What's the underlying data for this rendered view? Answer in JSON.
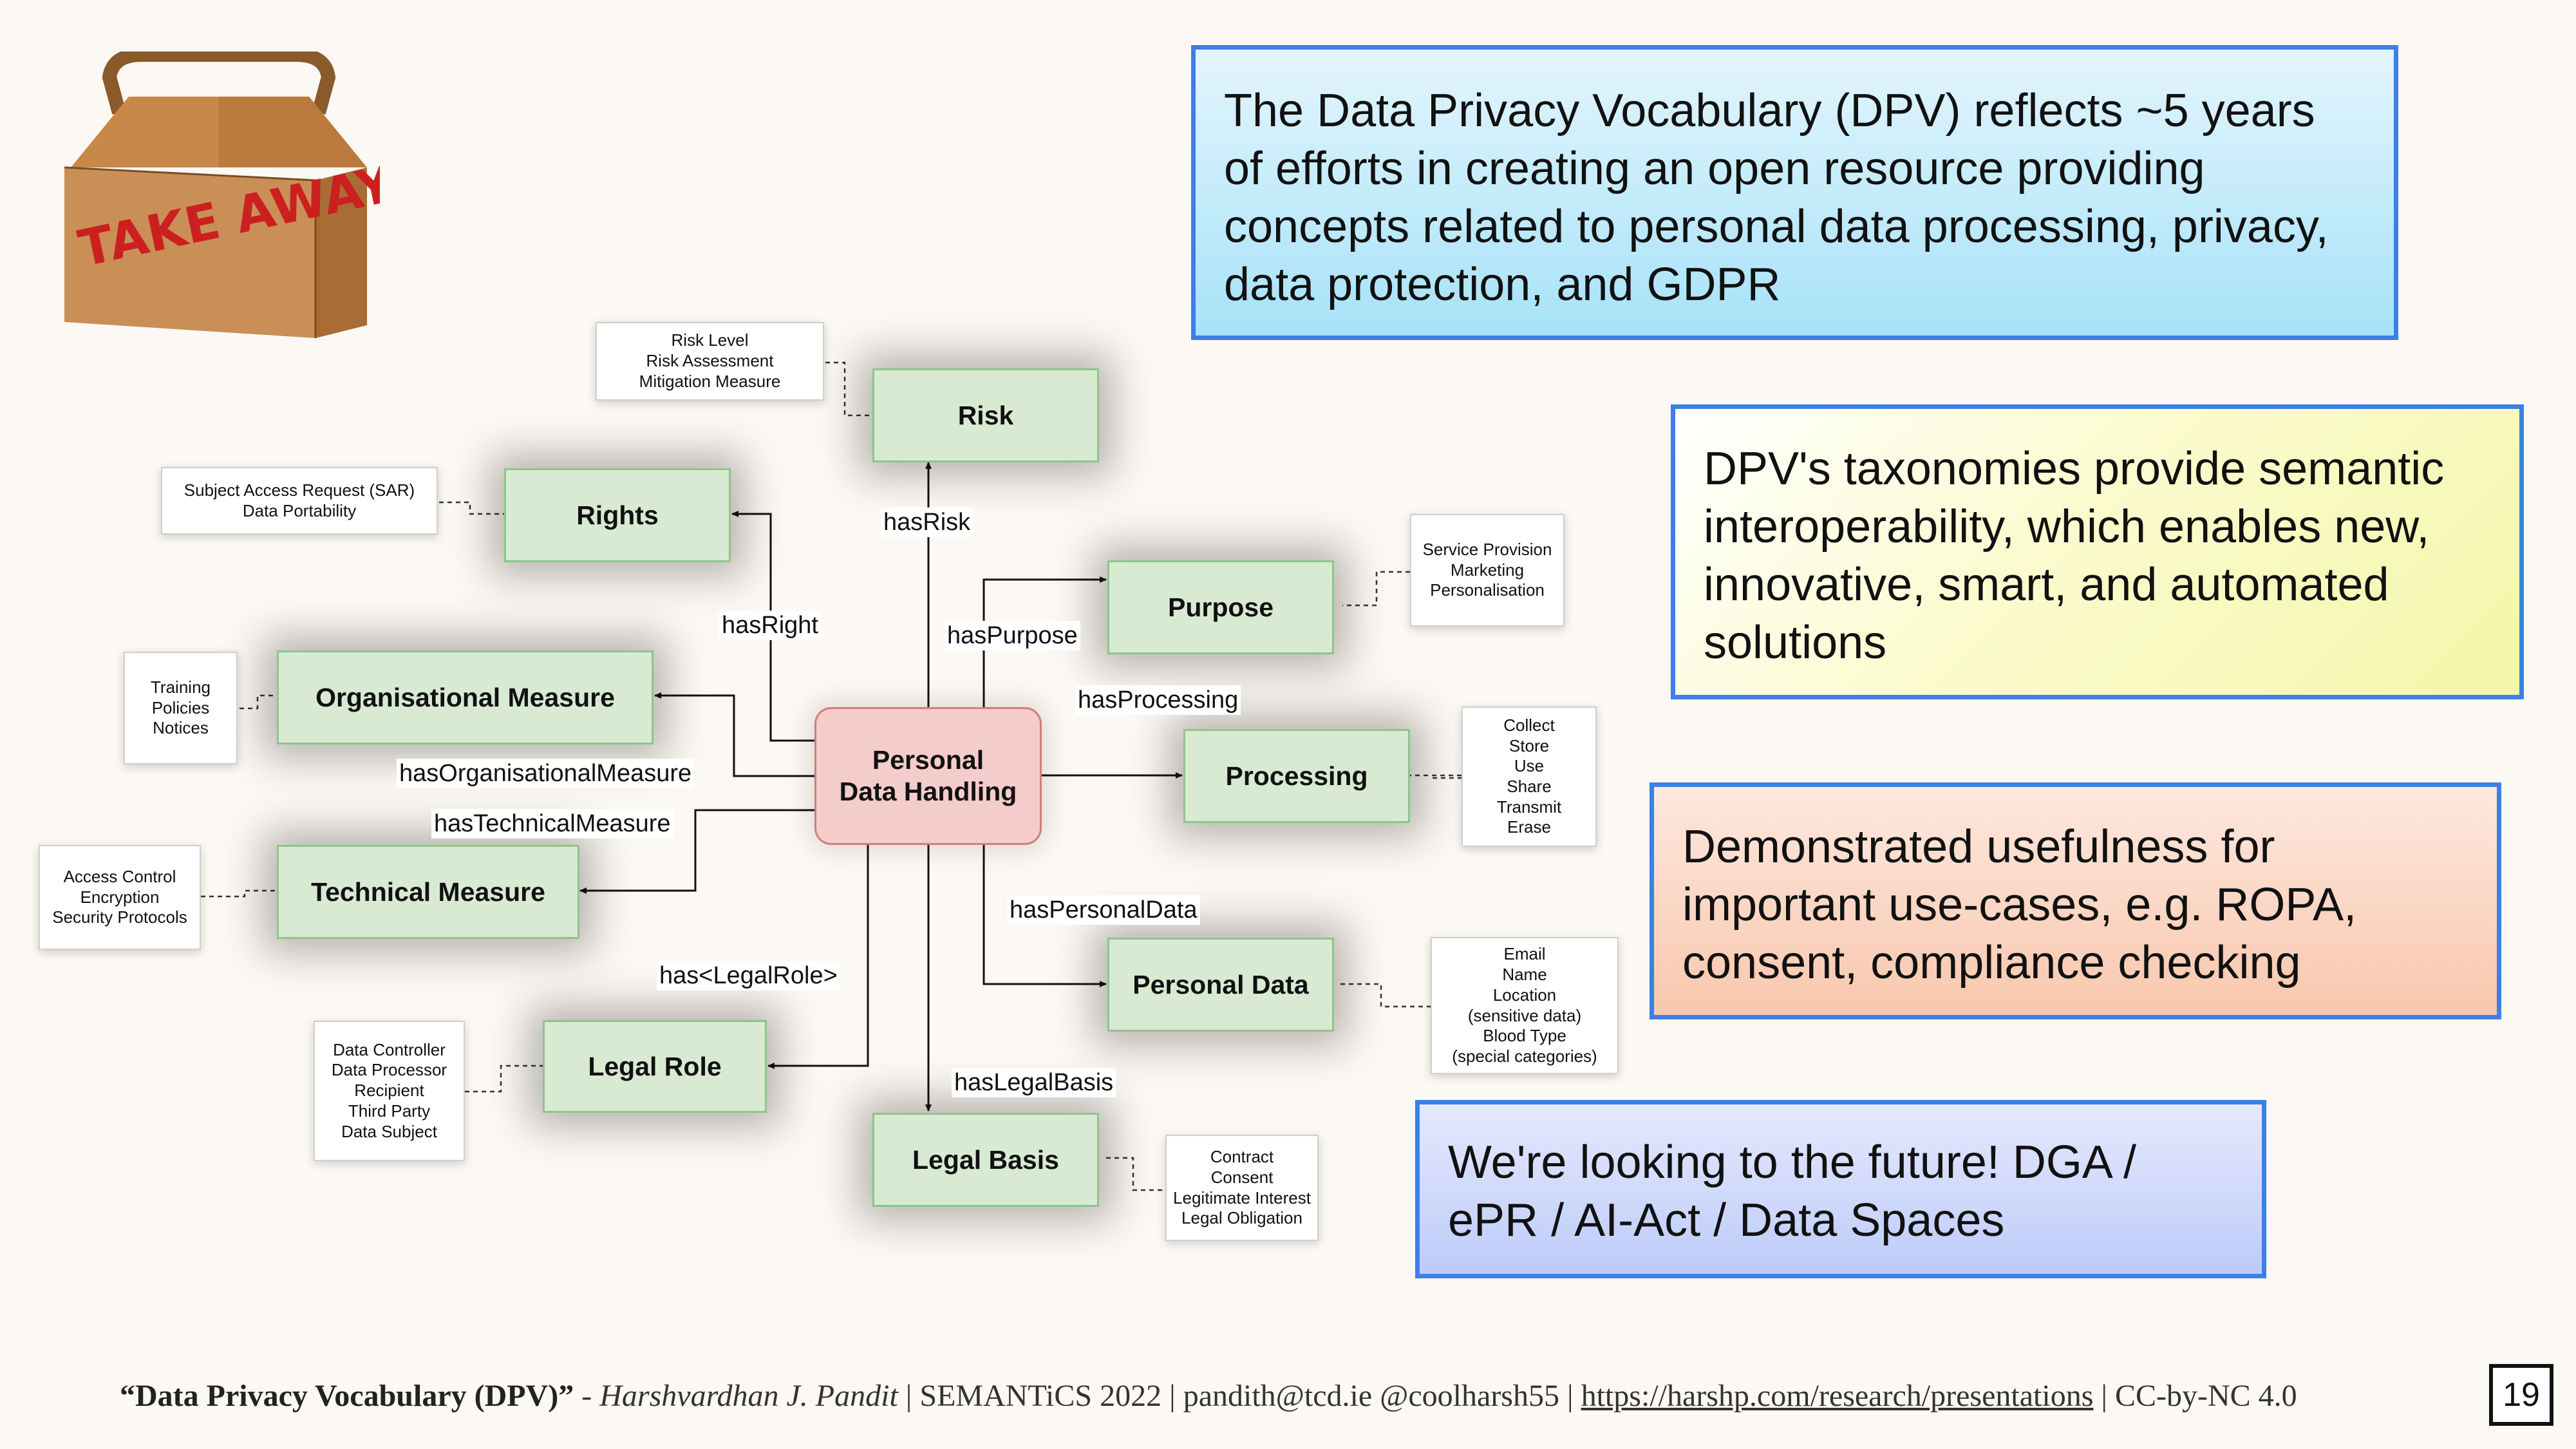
{
  "logo": {
    "text": "TAKE AWAY"
  },
  "diagram": {
    "center": {
      "label": "Personal\nData Handling"
    },
    "nodes": {
      "risk": "Risk",
      "rights": "Rights",
      "purpose": "Purpose",
      "org_measure": "Organisational Measure",
      "processing": "Processing",
      "tech_measure": "Technical Measure",
      "personal_data": "Personal Data",
      "legal_role": "Legal Role",
      "legal_basis": "Legal Basis"
    },
    "edges": {
      "has_risk": "hasRisk",
      "has_right": "hasRight",
      "has_purpose": "hasPurpose",
      "has_processing": "hasProcessing",
      "has_org_measure": "hasOrganisationalMeasure",
      "has_tech_measure": "hasTechnicalMeasure",
      "has_personal_data": "hasPersonalData",
      "has_legal_role": "has<LegalRole>",
      "has_legal_basis": "hasLegalBasis"
    },
    "notes": {
      "risk": [
        "Risk Level",
        "Risk Assessment",
        "Mitigation Measure"
      ],
      "rights": [
        "Subject Access Request (SAR)",
        "Data Portability"
      ],
      "purpose": [
        "Service Provision",
        "Marketing",
        "Personalisation"
      ],
      "org_measure": [
        "Training",
        "Policies",
        "Notices"
      ],
      "processing": [
        "Collect",
        "Store",
        "Use",
        "Share",
        "Transmit",
        "Erase"
      ],
      "tech_measure": [
        "Access Control",
        "Encryption",
        "Security Protocols"
      ],
      "personal_data": [
        "Email",
        "Name",
        "Location",
        "(sensitive data)",
        "Blood Type",
        "(special categories)"
      ],
      "legal_role": [
        "Data Controller",
        "Data Processor",
        "Recipient",
        "Third Party",
        "Data Subject"
      ],
      "legal_basis": [
        "Contract",
        "Consent",
        "Legitimate Interest",
        "Legal Obligation"
      ]
    }
  },
  "callouts": {
    "dpv": "The Data Privacy Vocabulary (DPV) reflects ~5 years of efforts in creating an open resource providing concepts related to personal data processing, privacy, data protection, and GDPR",
    "taxonomies": "DPV's taxonomies provide semantic interoperability, which enables new, innovative, smart, and automated solutions",
    "usefulness": "Demonstrated usefulness for important use-cases, e.g. ROPA, consent, compliance checking",
    "future": "We're looking to the future! DGA / ePR / AI-Act / Data Spaces"
  },
  "colors": {
    "callout_border": "#3d7fe6",
    "node_fill": "#d9ead3",
    "center_fill": "#f4cccc"
  },
  "footer": {
    "title": "“Data Privacy Vocabulary (DPV)”",
    "separator": " - ",
    "author": "Harshvardhan J. Pandit",
    "venue": " | SEMANTiCS 2022 | pandith@tcd.ie @coolharsh55 | ",
    "link": "https://harshp.com/research/presentations",
    "license": " | CC-by-NC 4.0",
    "page_number": "19"
  }
}
